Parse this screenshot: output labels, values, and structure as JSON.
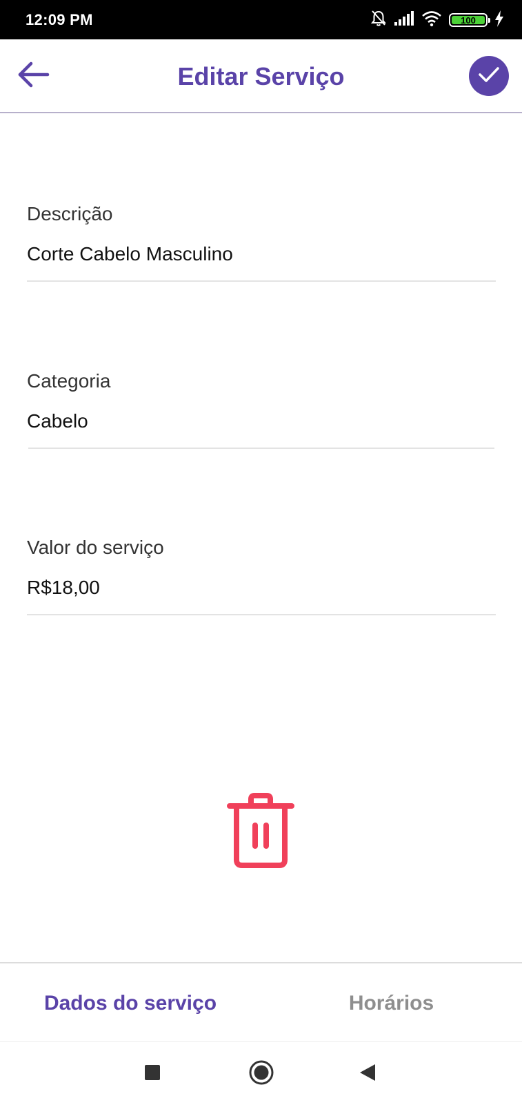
{
  "status_bar": {
    "time": "12:09 PM",
    "battery_level": "100",
    "icons": [
      "bell-off-icon",
      "signal-icon",
      "wifi-icon",
      "battery-icon",
      "charging-icon"
    ]
  },
  "app_bar": {
    "title": "Editar Serviço",
    "back_icon": "arrow-left-icon",
    "confirm_icon": "check-icon"
  },
  "form": {
    "fields": [
      {
        "label": "Descrição",
        "value": "Corte Cabelo Masculino"
      },
      {
        "label": "Categoria",
        "value": "Cabelo"
      },
      {
        "label": "Valor do serviço",
        "value": "R$18,00"
      }
    ]
  },
  "delete": {
    "icon": "trash-icon"
  },
  "tabs": [
    {
      "label": "Dados do serviço",
      "active": true
    },
    {
      "label": "Horários",
      "active": false
    }
  ],
  "nav_bar": {
    "buttons": [
      "recents-square-icon",
      "home-circle-icon",
      "back-triangle-icon"
    ]
  },
  "colors": {
    "accent": "#5a43a8",
    "danger": "#f0405a",
    "inactive_tab": "#8e8e8e",
    "status_bar": "#000000",
    "battery_fill": "#4cd137"
  }
}
